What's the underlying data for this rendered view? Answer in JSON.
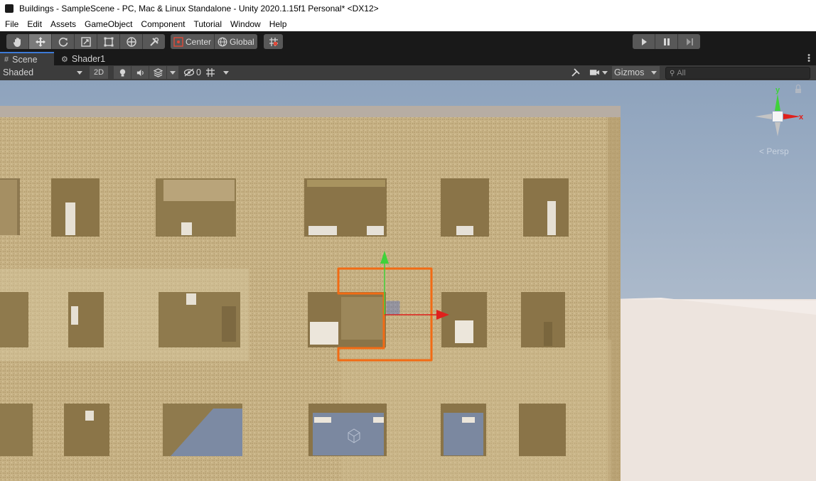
{
  "window": {
    "title": "Buildings - SampleScene - PC, Mac & Linux Standalone - Unity 2020.1.15f1 Personal* <DX12>"
  },
  "menu": [
    "File",
    "Edit",
    "Assets",
    "GameObject",
    "Component",
    "Tutorial",
    "Window",
    "Help"
  ],
  "toolbar": {
    "active_tool": "move",
    "pivot_label": "Center",
    "space_label": "Global"
  },
  "tabs": [
    {
      "label": "Scene",
      "active": true
    },
    {
      "label": "Shader1",
      "active": false
    }
  ],
  "scene_toolbar": {
    "draw_mode": "Shaded",
    "mode_2d": "2D",
    "hidden_count": "0",
    "gizmos_label": "Gizmos",
    "search_placeholder": "All"
  },
  "viewport": {
    "projection_label": "Persp",
    "axis_labels": {
      "y": "y",
      "x": "x"
    },
    "colors": {
      "sky": "#a3b4c8",
      "ground": "#eee6e0",
      "wall": "#c7b387",
      "selection": "#f26b14",
      "axis_x": "#e0201c",
      "axis_y": "#3fd23a",
      "axis_z": "#3a5fd0"
    }
  }
}
